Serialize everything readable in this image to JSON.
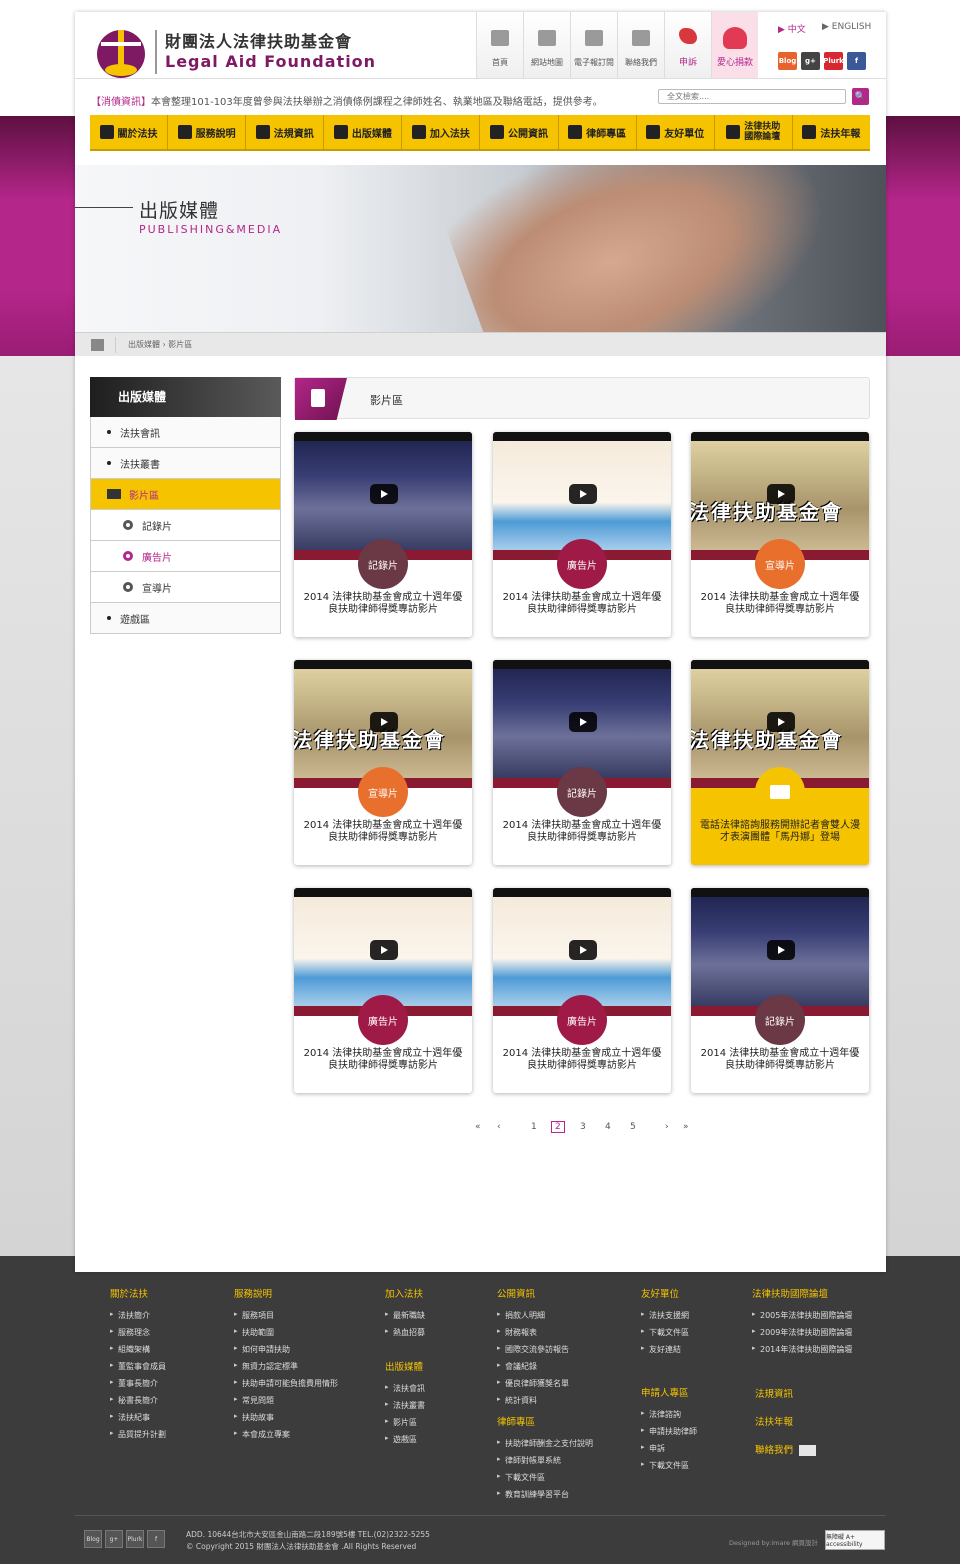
{
  "header": {
    "logo_zh": "財團法人法律扶助基金會",
    "logo_en": "Legal Aid Foundation",
    "topnav": [
      {
        "label": "首頁",
        "icon": "home-icon"
      },
      {
        "label": "網站地圖",
        "icon": "sitemap-icon"
      },
      {
        "label": "電子報訂閱",
        "icon": "mail-icon"
      },
      {
        "label": "聯絡我們",
        "icon": "contact-icon"
      },
      {
        "label": "申訴",
        "icon": "megaphone-icon"
      },
      {
        "label": "愛心捐款",
        "icon": "heart-icon"
      }
    ],
    "lang_zh": "▶ 中文",
    "lang_en": "▶ ENGLISH",
    "social": [
      "Blog",
      "g+",
      "Plurk",
      "f"
    ],
    "announcement_tag": "【消債資訊】",
    "announcement": "本會整理101-103年度曾參與法扶舉辦之消債條例課程之律師姓名、執業地區及聯絡電話，提供參考。",
    "search_placeholder": "全文檢索....",
    "search_button": "🔍"
  },
  "mainnav": [
    {
      "label": "關於法扶",
      "icon": "scale-icon"
    },
    {
      "label": "服務說明",
      "icon": "person-icon"
    },
    {
      "label": "法規資訊",
      "icon": "gavel-icon"
    },
    {
      "label": "出版媒體",
      "icon": "book-icon"
    },
    {
      "label": "加入法扶",
      "icon": "handshake-icon"
    },
    {
      "label": "公開資訊",
      "icon": "columns-icon"
    },
    {
      "label": "律師專區",
      "icon": "lawyer-icon"
    },
    {
      "label": "友好單位",
      "icon": "building-icon"
    },
    {
      "label": "法律扶助國際論壇",
      "line1": "法律扶助",
      "line2": "國際論壇",
      "icon": "globe-icon"
    },
    {
      "label": "法扶年報",
      "icon": "report-icon"
    }
  ],
  "banner": {
    "title_zh": "出版媒體",
    "title_en": "PUBLISHING&MEDIA"
  },
  "breadcrumb": {
    "text": "出版媒體 › 影片區"
  },
  "sidebar": {
    "title": "出版媒體",
    "items": [
      {
        "label": "法扶會訊"
      },
      {
        "label": "法扶叢書"
      },
      {
        "label": "影片區"
      },
      {
        "label": "記錄片"
      },
      {
        "label": "廣告片"
      },
      {
        "label": "宣導片"
      },
      {
        "label": "遊戲區"
      }
    ]
  },
  "section": {
    "title": "影片區"
  },
  "videos": [
    {
      "badge": "記錄片",
      "title": "2014 法律扶助基金會成立十週年優良扶助律師得獎專訪影片",
      "thumb": "interview"
    },
    {
      "badge": "廣告片",
      "title": "2014 法律扶助基金會成立十週年優良扶助律師得獎專訪影片",
      "thumb": "cartoon"
    },
    {
      "badge": "宣導片",
      "title": "2014 法律扶助基金會成立十週年優良扶助律師得獎專訪影片",
      "thumb": "press",
      "overlay": "法律扶助基金會"
    },
    {
      "badge": "宣導片",
      "title": "2014 法律扶助基金會成立十週年優良扶助律師得獎專訪影片",
      "thumb": "press",
      "overlay": "法律扶助基金會"
    },
    {
      "badge": "記錄片",
      "title": "2014 法律扶助基金會成立十週年優良扶助律師得獎專訪影片",
      "thumb": "interview"
    },
    {
      "badge": "",
      "title": "電話法律諮詢服務開辦記者會雙人漫才表演團體「馬丹娜」登場",
      "thumb": "press",
      "overlay": "法律扶助基金會",
      "highlight": true
    },
    {
      "badge": "廣告片",
      "title": "2014 法律扶助基金會成立十週年優良扶助律師得獎專訪影片",
      "thumb": "cartoon"
    },
    {
      "badge": "廣告片",
      "title": "2014 法律扶助基金會成立十週年優良扶助律師得獎專訪影片",
      "thumb": "cartoon"
    },
    {
      "badge": "記錄片",
      "title": "2014 法律扶助基金會成立十週年優良扶助律師得獎專訪影片",
      "thumb": "interview"
    }
  ],
  "pager": {
    "first": "«",
    "prev": "‹",
    "pages": [
      "1",
      "2",
      "3",
      "4",
      "5"
    ],
    "current": "2",
    "next": "›",
    "last": "»"
  },
  "footer": {
    "cols": [
      {
        "title": "關於法扶",
        "items": [
          "法扶簡介",
          "服務理念",
          "組織架構",
          "董監事會成員",
          "董事長簡介",
          "秘書長簡介",
          "法扶紀事",
          "品質提升計劃"
        ]
      },
      {
        "title": "服務說明",
        "items": [
          "服務項目",
          "扶助範圍",
          "如何申請扶助",
          "無資力認定標準",
          "扶助申請可能負擔費用情形",
          "常見問題",
          "扶助故事",
          "本會成立專案"
        ]
      },
      {
        "title": "加入法扶",
        "items": [
          "最新職缺",
          "熱血招募"
        ]
      },
      {
        "title": "出版媒體",
        "items": [
          "法扶會訊",
          "法扶叢書",
          "影片區",
          "遊戲區"
        ]
      },
      {
        "title": "公開資訊",
        "items": [
          "捐款人明細",
          "財務報表",
          "國際交流參訪報告",
          "會議紀錄",
          "優良律師獲獎名單",
          "統計資料"
        ]
      },
      {
        "title": "律師專區",
        "items": [
          "扶助律師酬金之支付說明",
          "律師對帳單系統",
          "下載文件區",
          "教育訓練學習平台"
        ]
      },
      {
        "title": "友好單位",
        "items": [
          "法扶支援網",
          "下載文件區",
          "友好連結"
        ]
      },
      {
        "title": "申請人專區",
        "items": [
          "法律諮詢",
          "申請扶助律師",
          "申訴",
          "下載文件區"
        ]
      },
      {
        "title": "法律扶助國際論壇",
        "items": [
          "2005年法律扶助國際論壇",
          "2009年法律扶助國際論壇",
          "2014年法律扶助國際論壇"
        ]
      }
    ],
    "links": {
      "law": "法規資訊",
      "report": "法扶年報",
      "contact": "聯絡我們"
    },
    "social": [
      "Blog",
      "g+",
      "Plurk",
      "f"
    ],
    "address": "ADD. 10644台北市大安區金山南路二段189號5樓   TEL.(02)2322-5255",
    "copyright": "© Copyright  2015   財團法人法律扶助基金會 .All Rights Reserved",
    "designer": "Designed by:imare 網頁設計",
    "accessibility": "無障礙 A+ accessibility"
  },
  "colors": {
    "brand": "#b4268a",
    "accent": "#f5c300",
    "footer_bg": "#3c3c3c"
  }
}
